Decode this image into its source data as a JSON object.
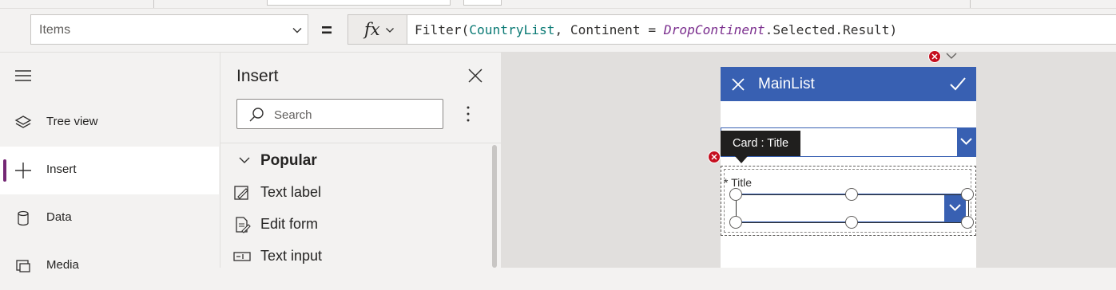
{
  "formula_bar": {
    "property": "Items",
    "equals": "=",
    "fx_label": "fx",
    "formula": {
      "func": "Filter(",
      "arg1": "CountryList",
      "mid": ", Continent = ",
      "control": "DropContinent",
      "tail": ".Selected.Result)"
    }
  },
  "left_nav": {
    "items": [
      {
        "label": "Tree view",
        "icon": "layers-icon"
      },
      {
        "label": "Insert",
        "icon": "plus-icon",
        "active": true
      },
      {
        "label": "Data",
        "icon": "database-icon"
      },
      {
        "label": "Media",
        "icon": "media-icon"
      }
    ]
  },
  "insert_pane": {
    "title": "Insert",
    "search_placeholder": "Search",
    "section": "Popular",
    "items": [
      {
        "label": "Text label",
        "icon": "text-label-icon"
      },
      {
        "label": "Edit form",
        "icon": "edit-form-icon"
      },
      {
        "label": "Text input",
        "icon": "text-input-icon"
      }
    ]
  },
  "canvas": {
    "screen_title": "MainList",
    "tooltip": "Card : Title",
    "card_label": "* Title",
    "colors": {
      "header": "#3860b2",
      "error": "#c50f1f",
      "accent": "#742774"
    }
  }
}
